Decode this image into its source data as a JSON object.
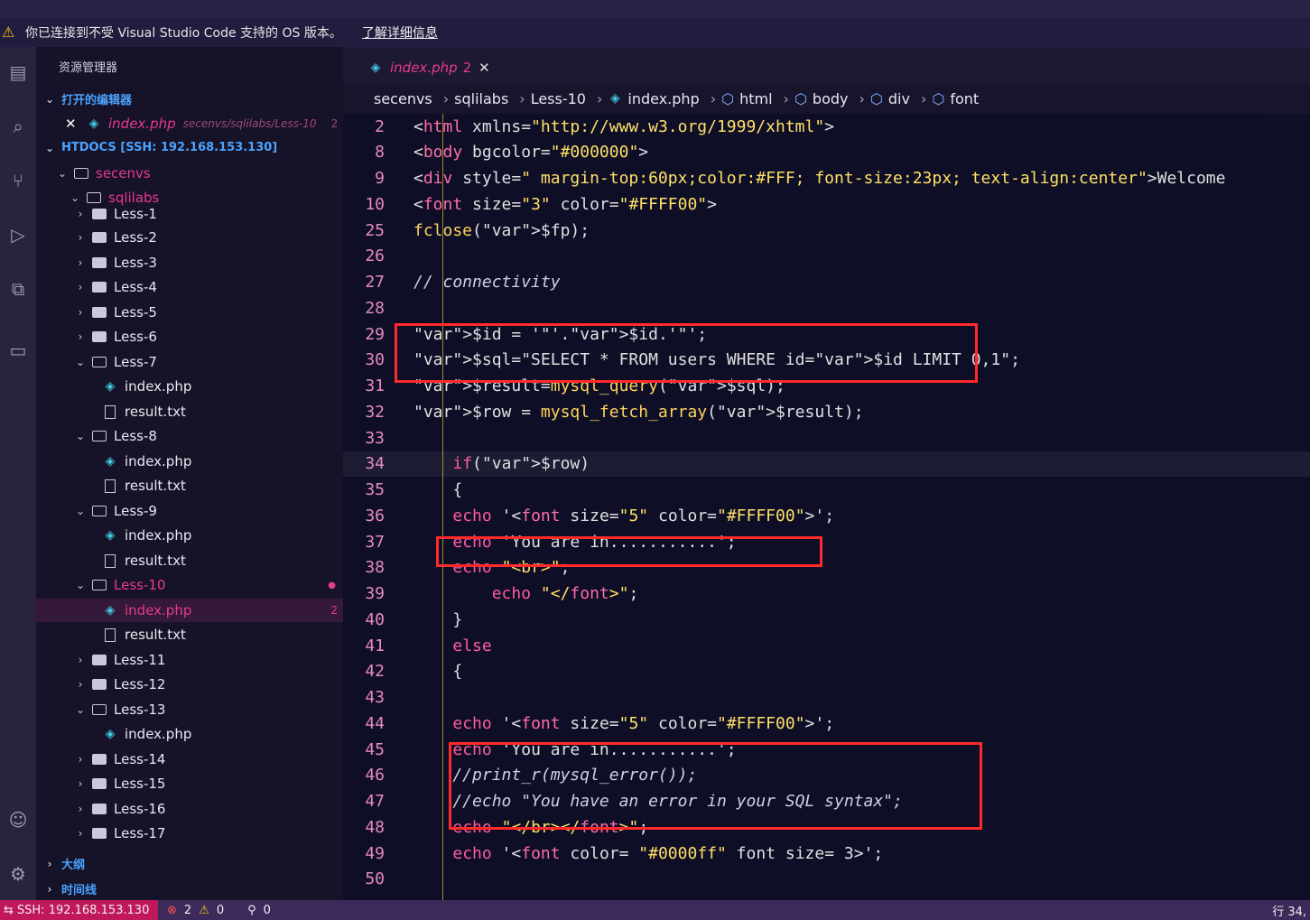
{
  "banner": {
    "message": "你已连接到不受 Visual Studio Code 支持的 OS 版本。",
    "link": "了解详细信息"
  },
  "explorer": {
    "title": "资源管理器",
    "open_editors": "打开的编辑器",
    "open_file_name": "index.php",
    "open_file_path": "secenvs/sqlilabs/Less-10",
    "open_file_badge": "2",
    "root": "HTDOCS [SSH: 192.168.153.130]",
    "folders": {
      "secenvs": "secenvs",
      "sqlilabs": "sqlilabs",
      "less1": "Less-1",
      "less2": "Less-2",
      "less3": "Less-3",
      "less4": "Less-4",
      "less5": "Less-5",
      "less6": "Less-6",
      "less7": "Less-7",
      "less8": "Less-8",
      "less9": "Less-9",
      "less10": "Less-10",
      "less11": "Less-11",
      "less12": "Less-12",
      "less13": "Less-13",
      "less14": "Less-14",
      "less15": "Less-15",
      "less16": "Less-16",
      "less17": "Less-17"
    },
    "files": {
      "index": "index.php",
      "result": "result.txt"
    },
    "less10_badge": "2",
    "outline": "大纲",
    "timeline": "时间线"
  },
  "editor": {
    "tab_name": "index.php",
    "tab_badge": "2",
    "breadcrumbs": [
      "secenvs",
      "sqlilabs",
      "Less-10",
      "index.php",
      "html",
      "body",
      "div",
      "font"
    ],
    "lines": [
      {
        "n": "2",
        "code": "<html xmlns=\"http://www.w3.org/1999/xhtml\">"
      },
      {
        "n": "8",
        "code": "<body bgcolor=\"#000000\">"
      },
      {
        "n": "9",
        "code": "<div style=\" margin-top:60px;color:#FFF; font-size:23px; text-align:center\">Welcome"
      },
      {
        "n": "10",
        "code": "<font size=\"3\" color=\"#FFFF00\">"
      },
      {
        "n": "25",
        "code": "fclose($fp);"
      },
      {
        "n": "26",
        "code": ""
      },
      {
        "n": "27",
        "code": "// connectivity"
      },
      {
        "n": "28",
        "code": ""
      },
      {
        "n": "29",
        "code": "$id = '\"'.$id.'\"';"
      },
      {
        "n": "30",
        "code": "$sql=\"SELECT * FROM users WHERE id=$id LIMIT 0,1\";"
      },
      {
        "n": "31",
        "code": "$result=mysql_query($sql);"
      },
      {
        "n": "32",
        "code": "$row = mysql_fetch_array($result);"
      },
      {
        "n": "33",
        "code": ""
      },
      {
        "n": "34",
        "code": "    if($row)"
      },
      {
        "n": "35",
        "code": "    {"
      },
      {
        "n": "36",
        "code": "    echo '<font size=\"5\" color=\"#FFFF00\">';"
      },
      {
        "n": "37",
        "code": "    echo 'You are in...........';"
      },
      {
        "n": "38",
        "code": "    echo \"<br>\";"
      },
      {
        "n": "39",
        "code": "        echo \"</font>\";"
      },
      {
        "n": "40",
        "code": "    }"
      },
      {
        "n": "41",
        "code": "    else"
      },
      {
        "n": "42",
        "code": "    {"
      },
      {
        "n": "43",
        "code": ""
      },
      {
        "n": "44",
        "code": "    echo '<font size=\"5\" color=\"#FFFF00\">';"
      },
      {
        "n": "45",
        "code": "    echo 'You are in...........';"
      },
      {
        "n": "46",
        "code": "    //print_r(mysql_error());"
      },
      {
        "n": "47",
        "code": "    //echo \"You have an error in your SQL syntax\";"
      },
      {
        "n": "48",
        "code": "    echo \"</br></font>\";"
      },
      {
        "n": "49",
        "code": "    echo '<font color= \"#0000ff\" font size= 3>';"
      },
      {
        "n": "50",
        "code": ""
      }
    ]
  },
  "status": {
    "remote": "SSH: 192.168.153.130",
    "errors": "2",
    "warnings": "0",
    "ports": "0",
    "cursor": "行 34,"
  },
  "colors": {
    "accent": "#4aa3ff",
    "highlight": "#ff2a2a",
    "remote_bg": "#c0185a",
    "gitmod": "#e63b8e"
  }
}
